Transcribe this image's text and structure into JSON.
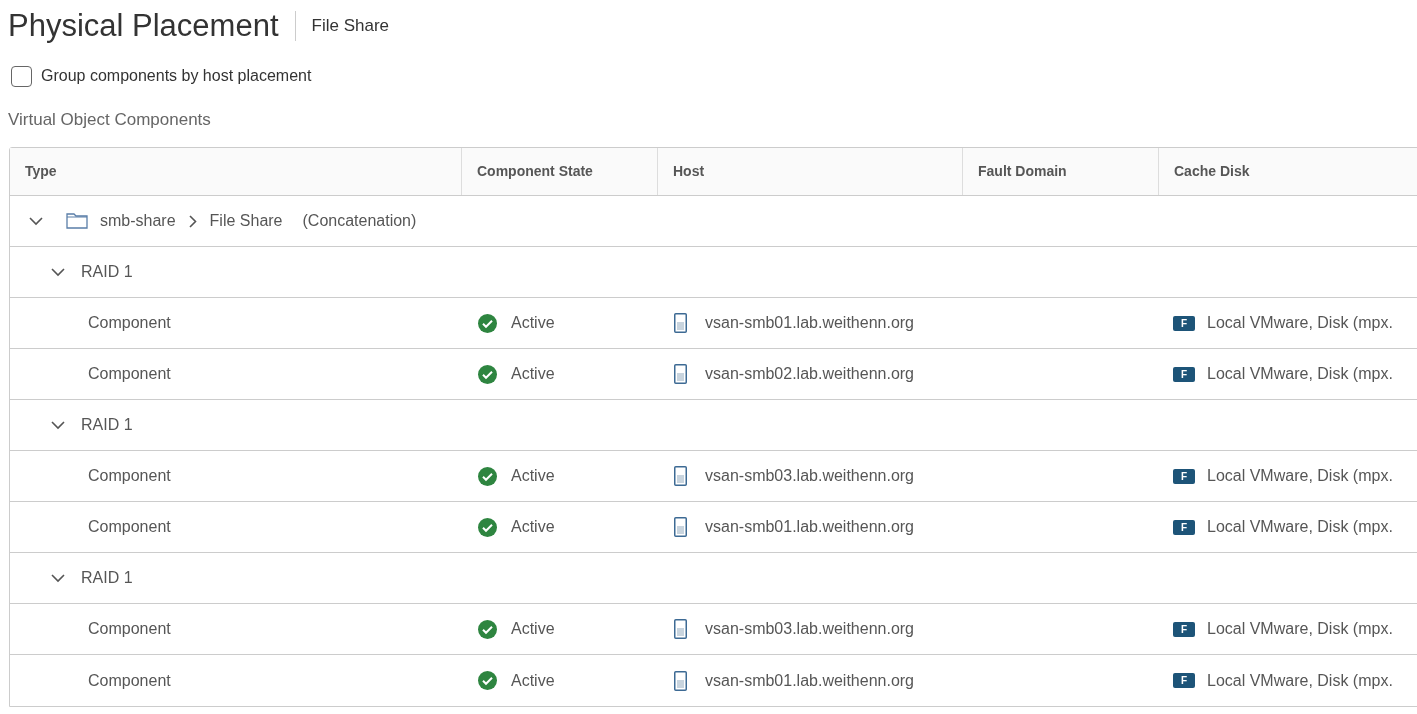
{
  "title": "Physical Placement",
  "subtitle": "File Share",
  "group_option": {
    "label": "Group components by host placement",
    "checked": false
  },
  "section_title": "Virtual Object Components",
  "table": {
    "columns": [
      "Type",
      "Component State",
      "Host",
      "Fault Domain",
      "Cache Disk"
    ],
    "rows": [
      {
        "kind": "object",
        "expanded": true,
        "name": "smb-share",
        "path": "File Share",
        "layout": "(Concatenation)",
        "children": [
          {
            "kind": "raid",
            "label": "RAID 1",
            "expanded": true,
            "children": [
              {
                "kind": "component",
                "type": "Component",
                "state": "Active",
                "host": "vsan-smb01.lab.weithenn.org",
                "cache_badge": "F",
                "cache_disk": "Local VMware, Disk (mpx."
              },
              {
                "kind": "component",
                "type": "Component",
                "state": "Active",
                "host": "vsan-smb02.lab.weithenn.org",
                "cache_badge": "F",
                "cache_disk": "Local VMware, Disk (mpx."
              }
            ]
          },
          {
            "kind": "raid",
            "label": "RAID 1",
            "expanded": true,
            "children": [
              {
                "kind": "component",
                "type": "Component",
                "state": "Active",
                "host": "vsan-smb03.lab.weithenn.org",
                "cache_badge": "F",
                "cache_disk": "Local VMware, Disk (mpx."
              },
              {
                "kind": "component",
                "type": "Component",
                "state": "Active",
                "host": "vsan-smb01.lab.weithenn.org",
                "cache_badge": "F",
                "cache_disk": "Local VMware, Disk (mpx."
              }
            ]
          },
          {
            "kind": "raid",
            "label": "RAID 1",
            "expanded": true,
            "children": [
              {
                "kind": "component",
                "type": "Component",
                "state": "Active",
                "host": "vsan-smb03.lab.weithenn.org",
                "cache_badge": "F",
                "cache_disk": "Local VMware, Disk (mpx."
              },
              {
                "kind": "component",
                "type": "Component",
                "state": "Active",
                "host": "vsan-smb01.lab.weithenn.org",
                "cache_badge": "F",
                "cache_disk": "Local VMware, Disk (mpx."
              }
            ]
          }
        ]
      }
    ]
  }
}
